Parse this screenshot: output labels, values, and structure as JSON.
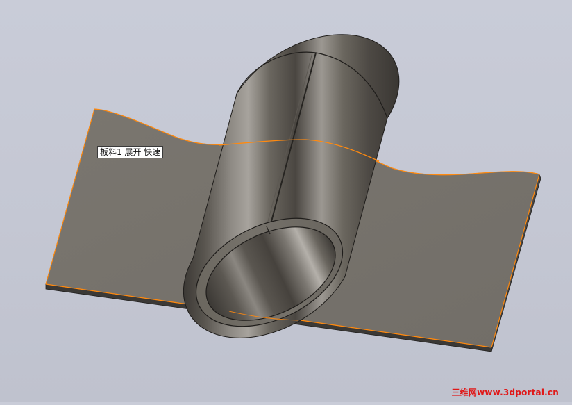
{
  "feature_callout": {
    "label": "板料1 展开 快速"
  },
  "watermark": {
    "text": "三维网www.3dportal.cn"
  },
  "colors": {
    "background": "#c6c9d5",
    "sheet_face": "#77736d",
    "sheet_edge": "#3b3936",
    "highlight_edge": "#ff8a10",
    "cylinder_dark": "#46423d",
    "cylinder_light": "#a29e98",
    "watermark": "#e01818"
  }
}
